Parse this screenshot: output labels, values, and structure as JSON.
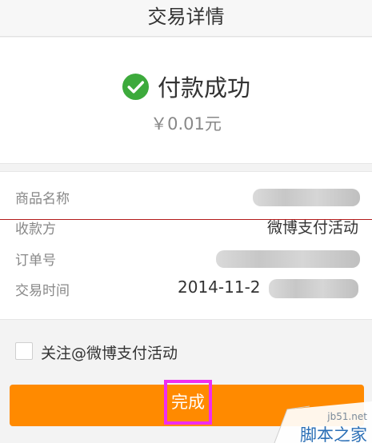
{
  "header": {
    "title": "交易详情"
  },
  "status": {
    "icon": "check-circle-icon",
    "text": "付款成功",
    "amount": "￥0.01元",
    "color": "#3daa3c"
  },
  "details": {
    "rows": [
      {
        "label": "商品名称",
        "value": ""
      },
      {
        "label": "收款方",
        "value": "微博支付活动"
      },
      {
        "label": "订单号",
        "value": ""
      },
      {
        "label": "交易时间",
        "value": "2014-11-2"
      }
    ]
  },
  "follow": {
    "label": "关注@微博支付活动",
    "checked": false
  },
  "action": {
    "done_label": "完成",
    "color": "#ff8a00",
    "highlight_color": "#f02cf0"
  },
  "watermark": {
    "url": "jb51.net",
    "text": "脚本之家"
  }
}
